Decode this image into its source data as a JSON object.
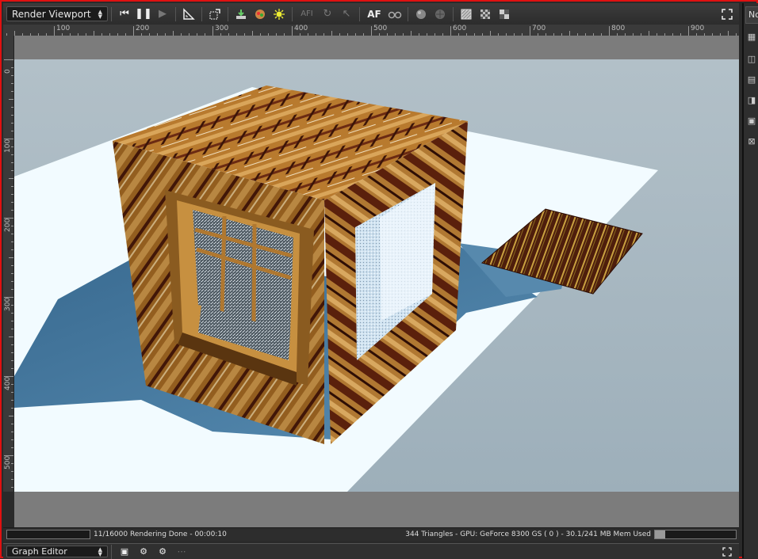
{
  "toolbar": {
    "viewport_select": "Render Viewport",
    "af_label": "AF",
    "af_dim_label": "AFI",
    "icons": [
      "skip-back-icon",
      "pause-icon",
      "play-icon",
      "ruler-angle-icon",
      "region-icon",
      "download-icon",
      "color-sphere-icon",
      "sun-icon",
      "af-dim-icon",
      "refresh-icon",
      "cursor-icon",
      "af-icon",
      "glasses-icon",
      "sphere-icon",
      "sphere-dark-icon",
      "texture-icon",
      "checker-icon",
      "contrast-icon",
      "fullscreen-icon"
    ]
  },
  "ruler": {
    "h_labels": [
      "100",
      "200",
      "300",
      "400",
      "500",
      "600",
      "700",
      "800",
      "900"
    ],
    "v_labels": [
      "0",
      "100",
      "200",
      "300",
      "400",
      "500"
    ]
  },
  "status": {
    "left": "11/16000 Rendering Done - 00:00:10",
    "right": "344 Triangles - GPU: GeForce 8300 GS ( 0 ) - 30.1/241 MB Mem Used",
    "memory_fraction": 0.125
  },
  "bottom_panel": {
    "select_label": "Graph Editor"
  },
  "right_panel": {
    "tab_label": "No"
  },
  "colors": {
    "accent": "#e01010",
    "sky": "#a9b9c2",
    "floor": "#f2fbff",
    "shadow": "#3e6f95"
  }
}
